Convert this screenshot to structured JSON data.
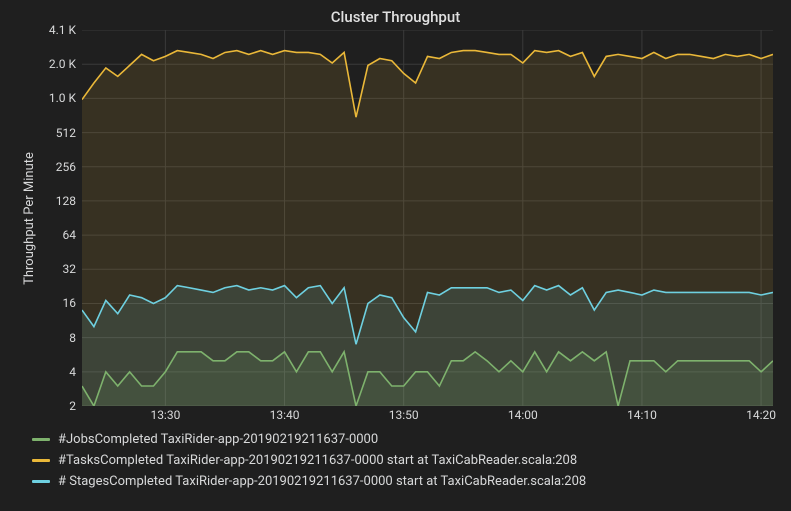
{
  "title": "Cluster Throughput",
  "ylabel": "Throughput Per Minute",
  "colors": {
    "jobs": "#7eb26d",
    "tasks": "#eab839",
    "stages": "#6ed0e0",
    "grid": "#3a3a3a"
  },
  "legend": {
    "jobs": "#JobsCompleted TaxiRider-app-20190219211637-0000",
    "tasks": "#TasksCompleted TaxiRider-app-20190219211637-0000 start at TaxiCabReader.scala:208",
    "stages": "# StagesCompleted TaxiRider-app-20190219211637-0000 start at TaxiCabReader.scala:208"
  },
  "chart_data": {
    "type": "line",
    "xlabel": "",
    "ylabel": "Throughput Per Minute",
    "title": "Cluster Throughput",
    "yaxis_scale": "log2",
    "ylim": [
      2,
      4100
    ],
    "x": [
      "13:23",
      "13:24",
      "13:25",
      "13:26",
      "13:27",
      "13:28",
      "13:29",
      "13:30",
      "13:31",
      "13:32",
      "13:33",
      "13:34",
      "13:35",
      "13:36",
      "13:37",
      "13:38",
      "13:39",
      "13:40",
      "13:41",
      "13:42",
      "13:43",
      "13:44",
      "13:45",
      "13:46",
      "13:47",
      "13:48",
      "13:49",
      "13:50",
      "13:51",
      "13:52",
      "13:53",
      "13:54",
      "13:55",
      "13:56",
      "13:57",
      "13:58",
      "13:59",
      "14:00",
      "14:01",
      "14:02",
      "14:03",
      "14:04",
      "14:05",
      "14:06",
      "14:07",
      "14:08",
      "14:09",
      "14:10",
      "14:11",
      "14:12",
      "14:13",
      "14:14",
      "14:15",
      "14:16",
      "14:17",
      "14:18",
      "14:19",
      "14:20",
      "14:21"
    ],
    "x_ticks": [
      "13:30",
      "13:40",
      "13:50",
      "14:00",
      "14:10",
      "14:20"
    ],
    "y_ticks": [
      2,
      4,
      8,
      16,
      32,
      64,
      128,
      256,
      512,
      1024,
      2048,
      4096
    ],
    "y_tick_labels": [
      "2",
      "4",
      "8",
      "16",
      "32",
      "64",
      "128",
      "256",
      "512",
      "1.0 K",
      "2.0 K",
      "4.1 K"
    ],
    "series": [
      {
        "name": "#JobsCompleted TaxiRider-app-20190219211637-0000",
        "key": "jobs",
        "values": [
          3,
          2,
          4,
          3,
          4,
          3,
          3,
          4,
          6,
          6,
          6,
          5,
          5,
          6,
          6,
          5,
          5,
          6,
          4,
          6,
          6,
          4,
          6,
          2,
          4,
          4,
          3,
          3,
          4,
          4,
          3,
          5,
          5,
          6,
          5,
          4,
          5,
          4,
          6,
          4,
          6,
          5,
          6,
          5,
          6,
          2,
          5,
          5,
          5,
          4,
          5,
          5,
          5,
          5,
          5,
          5,
          5,
          4,
          5
        ]
      },
      {
        "name": "#TasksCompleted TaxiRider-app-20190219211637-0000 start at TaxiCabReader.scala:208",
        "key": "tasks",
        "values": [
          1000,
          1400,
          1900,
          1600,
          2000,
          2500,
          2200,
          2400,
          2700,
          2600,
          2500,
          2300,
          2600,
          2700,
          2500,
          2700,
          2500,
          2700,
          2600,
          2600,
          2500,
          2100,
          2600,
          700,
          2000,
          2300,
          2200,
          1700,
          1400,
          2400,
          2300,
          2600,
          2700,
          2700,
          2600,
          2500,
          2500,
          2100,
          2700,
          2600,
          2700,
          2400,
          2600,
          1600,
          2400,
          2500,
          2400,
          2300,
          2600,
          2300,
          2500,
          2500,
          2400,
          2300,
          2500,
          2400,
          2500,
          2300,
          2500
        ]
      },
      {
        "name": "# StagesCompleted TaxiRider-app-20190219211637-0000 start at TaxiCabReader.scala:208",
        "key": "stages",
        "values": [
          14,
          10,
          17,
          13,
          19,
          18,
          16,
          18,
          23,
          22,
          21,
          20,
          22,
          23,
          21,
          22,
          21,
          23,
          18,
          22,
          23,
          16,
          22,
          7,
          16,
          19,
          18,
          12,
          9,
          20,
          19,
          22,
          22,
          22,
          22,
          20,
          21,
          17,
          23,
          21,
          23,
          19,
          22,
          14,
          20,
          21,
          20,
          19,
          21,
          20,
          20,
          20,
          20,
          20,
          20,
          20,
          20,
          19,
          20
        ]
      }
    ]
  }
}
